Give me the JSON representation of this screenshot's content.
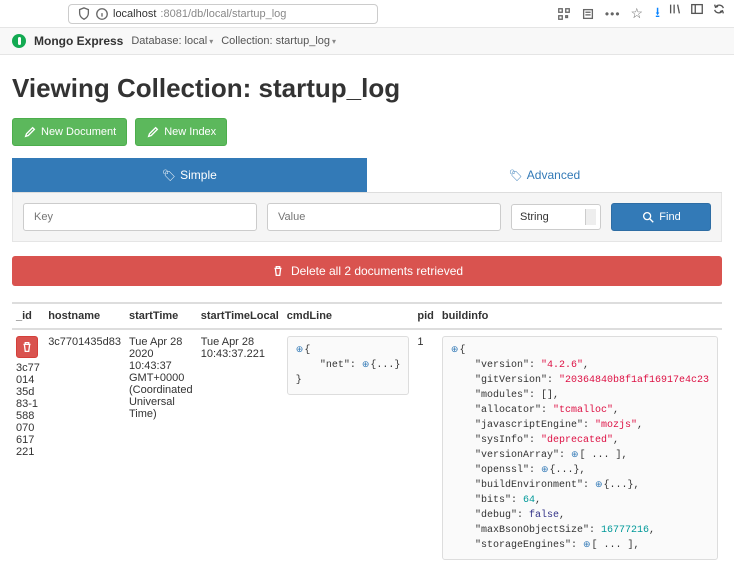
{
  "url": {
    "host": "localhost",
    "port_and_path": ":8081/db/local/startup_log"
  },
  "nav": {
    "brand": "Mongo Express",
    "db_label": "Database: local",
    "coll_label": "Collection: startup_log"
  },
  "heading": "Viewing Collection: startup_log",
  "buttons": {
    "new_doc": "New Document",
    "new_index": "New Index",
    "find": "Find"
  },
  "tabs": {
    "simple": "Simple",
    "advanced": "Advanced"
  },
  "search": {
    "key_ph": "Key",
    "value_ph": "Value",
    "type": "String"
  },
  "delete_bar": "Delete all 2 documents retrieved",
  "columns": {
    "id": "_id",
    "hostname": "hostname",
    "startTime": "startTime",
    "startTimeLocal": "startTimeLocal",
    "cmdLine": "cmdLine",
    "pid": "pid",
    "buildinfo": "buildinfo"
  },
  "row": {
    "id": "3c7701435d83-1588070617221",
    "hostname": "3c7701435d83",
    "startTime": "Tue Apr 28 2020 10:43:37 GMT+0000 (Coordinated Universal Time)",
    "startTimeLocal": "Tue Apr 28 10:43:37.221",
    "pid": "1",
    "cmdLine": {
      "net_key": "\"net\""
    },
    "buildinfo": {
      "version": "\"4.2.6\"",
      "gitVersion": "\"20364840b8f1af16917e4c23",
      "modules": "[]",
      "allocator": "\"tcmalloc\"",
      "javascriptEngine": "\"mozjs\"",
      "sysInfo": "\"deprecated\"",
      "bits": "64",
      "debug": "false",
      "maxBsonObjectSize": "16777216"
    }
  }
}
